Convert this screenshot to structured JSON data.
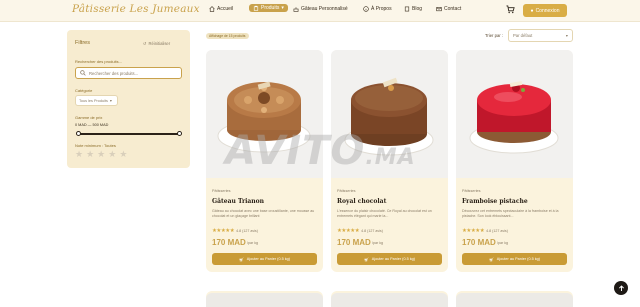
{
  "brand": {
    "logo_text": "Pâtisserie Les Jumeaux"
  },
  "nav": {
    "home": "Accueil",
    "products": "Produits",
    "custom_cake": "Gâteau Personnalisé",
    "about": "À Propos",
    "blog": "Blog",
    "contact": "Contact",
    "connect": "Connexion"
  },
  "results": {
    "count_label": "Affichage de 15 produits"
  },
  "sort": {
    "label": "Trier par :",
    "selected": "Par défaut"
  },
  "filters": {
    "title": "Filtres",
    "reset": "Réinitialiser",
    "search_label": "Rechercher des produits...",
    "search_placeholder": "Rechercher des produits...",
    "category_label": "Catégorie",
    "category_selected": "Tous les Produits",
    "price_label": "Gamme de prix",
    "price_range": "0 MAD — 500 MAD",
    "price_min_fraction": 0,
    "price_max_fraction": 1,
    "rating_label": "Note minimum : Toutes"
  },
  "products": [
    {
      "category": "Pâtisseries",
      "name": "Gâteau Trianon",
      "description": "Gâteau au chocolat avec une base croustillante, une mousse au chocolat et un glaçage brillant",
      "rating": "4.8 (127 avis)",
      "price": "170 MAD",
      "unit": "/par kg",
      "add_label": "Ajouter au Panier (0.5 kg)"
    },
    {
      "category": "Pâtisseries",
      "name": "Royal chocolat",
      "description": "L'essence du plaisir chocolaté. Ce Royal au chocolat est un entremets élégant qui marie la...",
      "rating": "4.8 (127 avis)",
      "price": "170 MAD",
      "unit": "/par kg",
      "add_label": "Ajouter au Panier (0.5 kg)"
    },
    {
      "category": "Pâtisseries",
      "name": "Framboise pistache",
      "description": "Découvrez cet entremets spectaculaire à la framboise et à la pistache. Son look éblouissant...",
      "rating": "4.8 (127 avis)",
      "price": "170 MAD",
      "unit": "/par kg",
      "add_label": "Ajouter au Panier (0.5 kg)"
    }
  ],
  "watermark": {
    "main": "AVITO",
    "suffix": ".MA"
  },
  "colors": {
    "accent": "#c9a24c",
    "button": "#c99b35",
    "panel": "#f7ecd0",
    "card": "#fbf3dd"
  }
}
